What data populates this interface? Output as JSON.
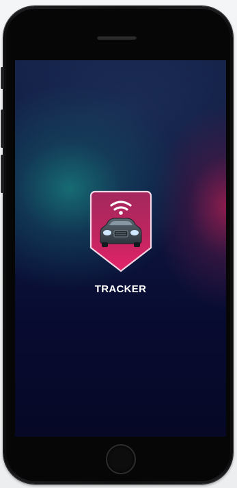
{
  "app": {
    "name": "TRACKER",
    "icon": "car-wifi-shield-icon"
  },
  "colors": {
    "icon_top": "#c02868",
    "icon_bottom": "#e3246a",
    "icon_border": "#f4d7e4",
    "screen_teal": "#177076",
    "screen_magenta": "#a01e50",
    "screen_navy": "#080b30"
  }
}
